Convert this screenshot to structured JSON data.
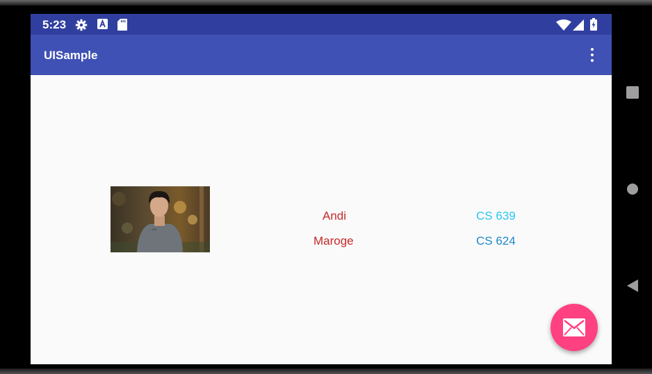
{
  "status_bar": {
    "time": "5:23",
    "icons": [
      "settings-icon",
      "a-notification-icon",
      "sd-card-icon",
      "wifi-icon",
      "signal-icon",
      "battery-icon"
    ]
  },
  "app_bar": {
    "title": "UISample",
    "menu_icon": "more-vert-icon"
  },
  "main": {
    "image": "person-photo",
    "rows": [
      {
        "name": "Andi",
        "course": "CS 639"
      },
      {
        "name": "Maroge",
        "course": "CS 624"
      }
    ]
  },
  "fab": {
    "icon": "email-icon",
    "color": "#ff4081"
  },
  "nav_bar": {
    "buttons": [
      "recents-icon",
      "home-icon",
      "back-icon"
    ]
  },
  "colors": {
    "primary": "#3f51b5",
    "primary_dark": "#303f9f",
    "accent": "#ff4081",
    "name_text": "#c62828",
    "course_text_1": "#29c8f0",
    "course_text_2": "#1e88c8"
  }
}
